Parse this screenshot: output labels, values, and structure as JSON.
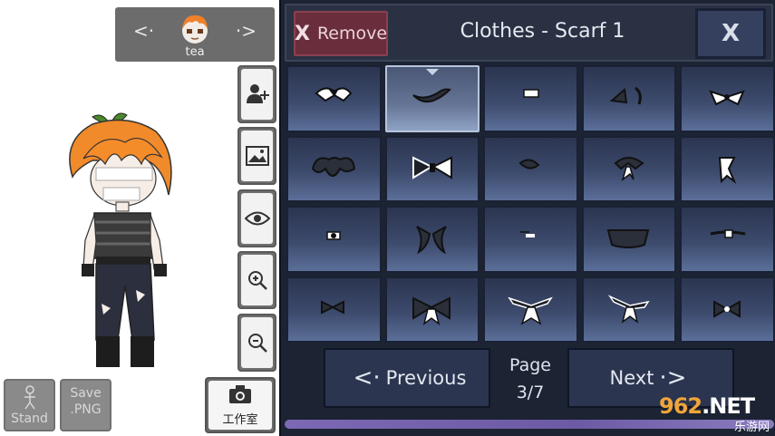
{
  "character": {
    "name": "tea",
    "prev_icon": "chevron-left-icon",
    "next_icon": "chevron-right-icon"
  },
  "tools": [
    {
      "name": "add-character-icon"
    },
    {
      "name": "background-image-icon"
    },
    {
      "name": "eye-icon"
    },
    {
      "name": "zoom-in-icon"
    },
    {
      "name": "zoom-out-icon"
    }
  ],
  "bottom_left": {
    "stand_label": "Stand",
    "save_label_1": "Save",
    "save_label_2": ".PNG",
    "studio_label": "工作室"
  },
  "panel": {
    "remove_x": "X",
    "remove_label": "Remove",
    "title": "Clothes - Scarf 1",
    "close_label": "X",
    "selected_index": 1,
    "items": [
      "scarf-item-1",
      "scarf-item-2",
      "scarf-item-3",
      "scarf-item-4",
      "scarf-item-5",
      "scarf-item-6",
      "scarf-item-7",
      "scarf-item-8",
      "scarf-item-9",
      "scarf-item-10",
      "scarf-item-11",
      "scarf-item-12",
      "scarf-item-13",
      "scarf-item-14",
      "scarf-item-15",
      "scarf-item-16",
      "scarf-item-17",
      "scarf-item-18",
      "scarf-item-19",
      "scarf-item-20"
    ]
  },
  "pager": {
    "previous_label": "Previous",
    "next_label": "Next",
    "page_label": "Page",
    "page_value": "3/7"
  },
  "watermark": {
    "main": "962",
    "suffix": ".NET",
    "sub": "乐游网"
  },
  "colors": {
    "panel_bg": "#1c2333",
    "cell_top": "#2b3550",
    "cell_bottom": "#5b6f99",
    "remove_bg": "#6a2d3b",
    "scrollbar": "#7c68b4"
  }
}
